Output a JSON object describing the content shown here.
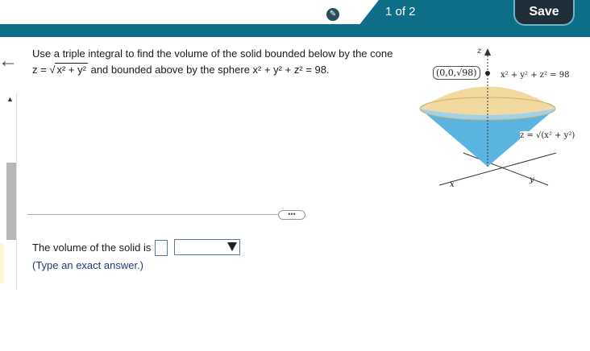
{
  "header": {
    "page_indicator": "1 of 2",
    "save_label": "Save"
  },
  "question": {
    "line1": "Use a triple integral to find the volume of the solid bounded below by the cone",
    "cone_lhs": "z =",
    "cone_radicand": "x² + y²",
    "line2_rest": "and bounded above by the sphere x² + y² + z² = 98."
  },
  "figure": {
    "point_label": "(0,0,√98)",
    "sphere_label": "x² + y² + z² = 98",
    "cone_label": "z = √(x² + y²)",
    "axis_z": "z",
    "axis_x": "x",
    "axis_y": "y",
    "colors": {
      "cap": "#f2d9a0",
      "cone": "#5bb3e0"
    }
  },
  "answer": {
    "label": "The volume of the solid is",
    "input_value": "",
    "select_value": "",
    "hint": "(Type an exact answer.)"
  },
  "divider_label": "•••"
}
